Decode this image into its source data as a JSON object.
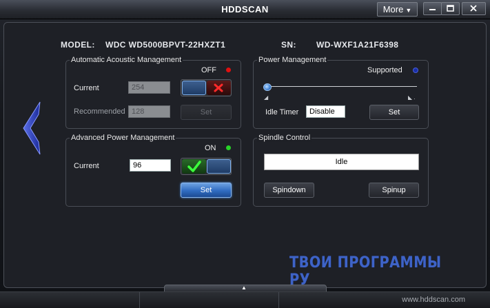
{
  "window": {
    "title": "HDDSCAN",
    "more_label": "More",
    "controls": [
      "minimize",
      "maximize",
      "close"
    ]
  },
  "device": {
    "model_label": "MODEL:",
    "model_value": "WDC WD5000BPVT-22HXZT1",
    "sn_label": "SN:",
    "sn_value": "WD-WXF1A21F6398"
  },
  "aam": {
    "title": "Automatic Acoustic Management",
    "status": "OFF",
    "status_color": "#e01010",
    "current_label": "Current",
    "current_value": "254",
    "recommended_label": "Recommended",
    "recommended_value": "128",
    "set_label": "Set"
  },
  "apm": {
    "title": "Advanced Power Management",
    "status": "ON",
    "status_color": "#28d428",
    "current_label": "Current",
    "current_value": "96",
    "set_label": "Set"
  },
  "power": {
    "title": "Power Management",
    "status": "Supported",
    "status_color": "#1a2fa8",
    "slider_value": 0,
    "idle_timer_label": "Idle Timer",
    "idle_timer_value": "Disable",
    "set_label": "Set"
  },
  "spindle": {
    "title": "Spindle Control",
    "state": "Idle",
    "spindown_label": "Spindown",
    "spinup_label": "Spinup"
  },
  "watermark": "ТВОИ ПРОГРАММЫ РУ",
  "status_bar": {
    "site": "www.hddscan.com"
  },
  "colors": {
    "accent_blue": "#2f6bc0",
    "watermark": "#3e63c7"
  }
}
